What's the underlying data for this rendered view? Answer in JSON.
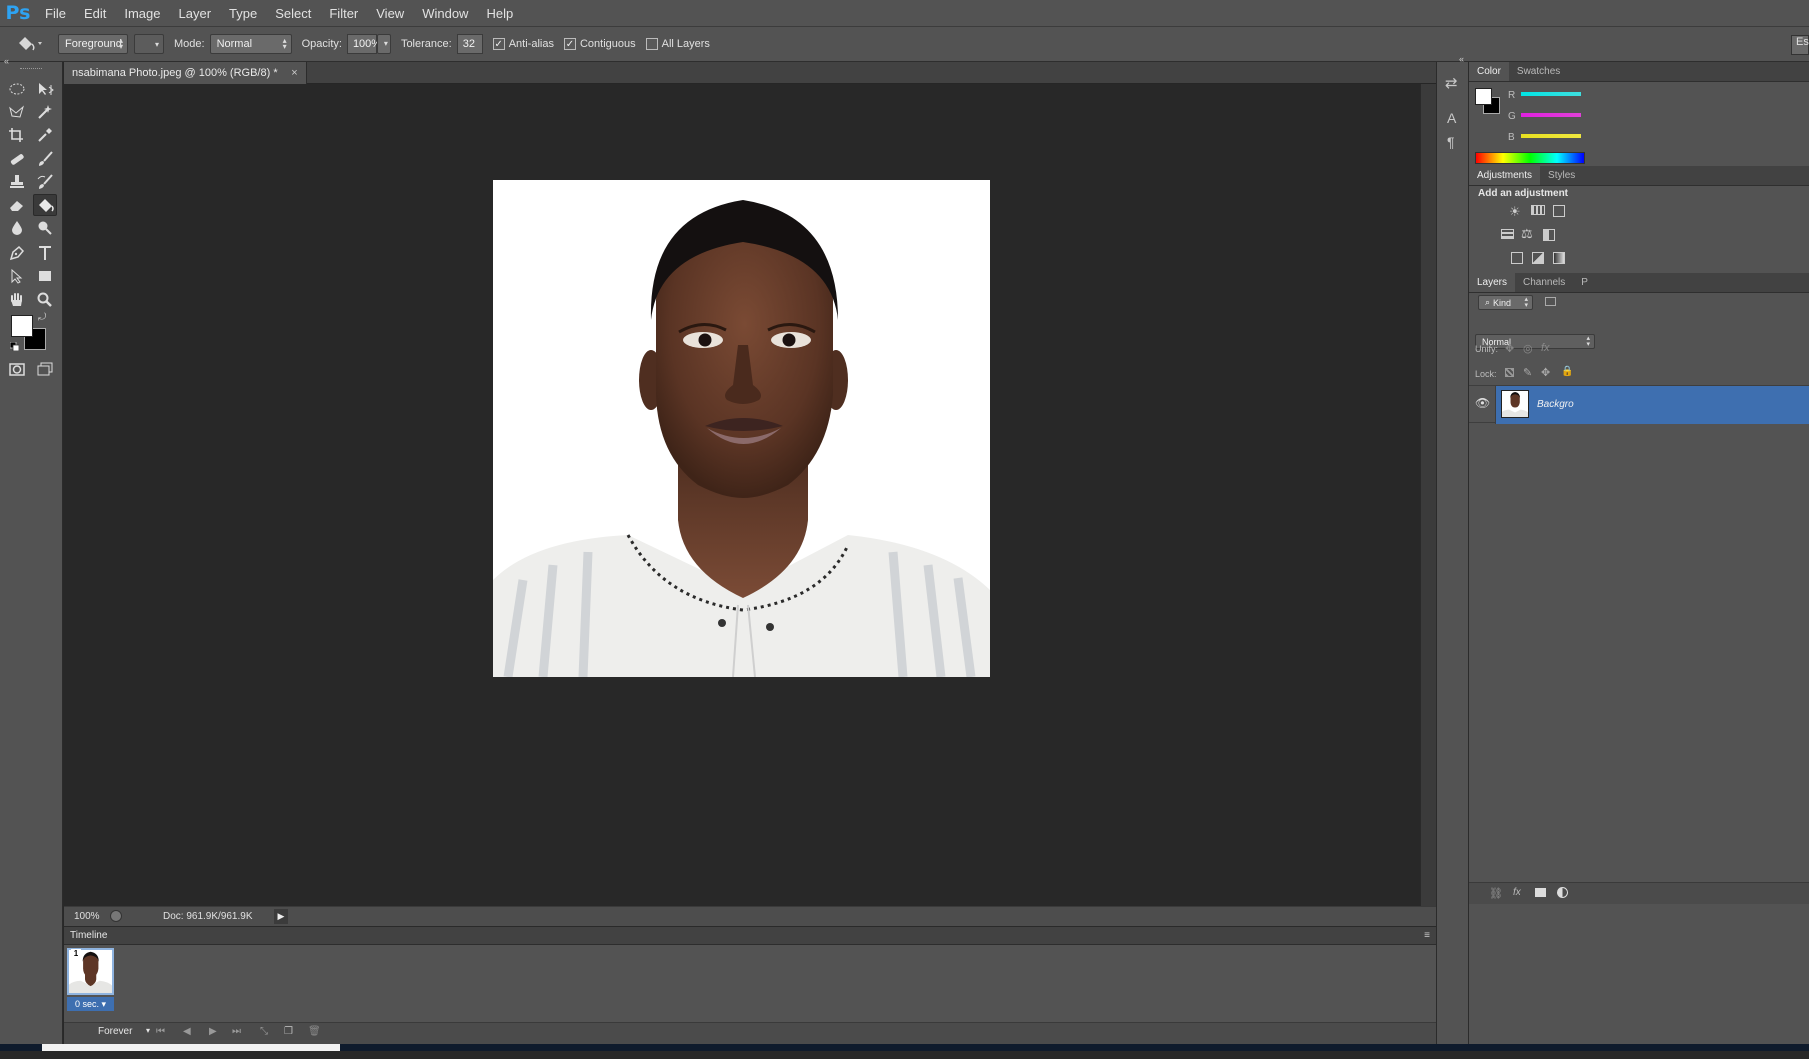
{
  "app": {
    "logo": "Ps"
  },
  "menu": [
    "File",
    "Edit",
    "Image",
    "Layer",
    "Type",
    "Select",
    "Filter",
    "View",
    "Window",
    "Help"
  ],
  "options": {
    "fill_source": "Foreground",
    "mode_label": "Mode:",
    "mode_value": "Normal",
    "opacity_label": "Opacity:",
    "opacity_value": "100%",
    "tolerance_label": "Tolerance:",
    "tolerance_value": "32",
    "antialias_label": "Anti-alias",
    "antialias_checked": true,
    "contiguous_label": "Contiguous",
    "contiguous_checked": true,
    "all_layers_label": "All Layers",
    "all_layers_checked": false,
    "workspace_btn": "Es"
  },
  "document": {
    "tab_title": "nsabimana Photo.jpeg @ 100% (RGB/8) *",
    "close_glyph": "×",
    "zoom": "100%",
    "doc_size": "Doc: 961.9K/961.9K"
  },
  "timeline": {
    "title": "Timeline",
    "frame_number": "1",
    "frame_delay": "0 sec.",
    "loop": "Forever"
  },
  "panels": {
    "color_tabs": [
      "Color",
      "Swatches"
    ],
    "color_channels": [
      "R",
      "G",
      "B"
    ],
    "adjustments_tabs": [
      "Adjustments",
      "Styles"
    ],
    "adjustments_heading": "Add an adjustment",
    "layers_tabs": [
      "Layers",
      "Channels",
      "P"
    ],
    "filter_kind": "Kind",
    "blend_mode": "Normal",
    "unify_label": "Unify:",
    "lock_label": "Lock:",
    "layer_name": "Backgro"
  },
  "colors": {
    "ui_bg": "#535353",
    "canvas_bg": "#282828",
    "accent": "#2ea3f2",
    "foreground": "#ffffff",
    "background": "#000000"
  }
}
